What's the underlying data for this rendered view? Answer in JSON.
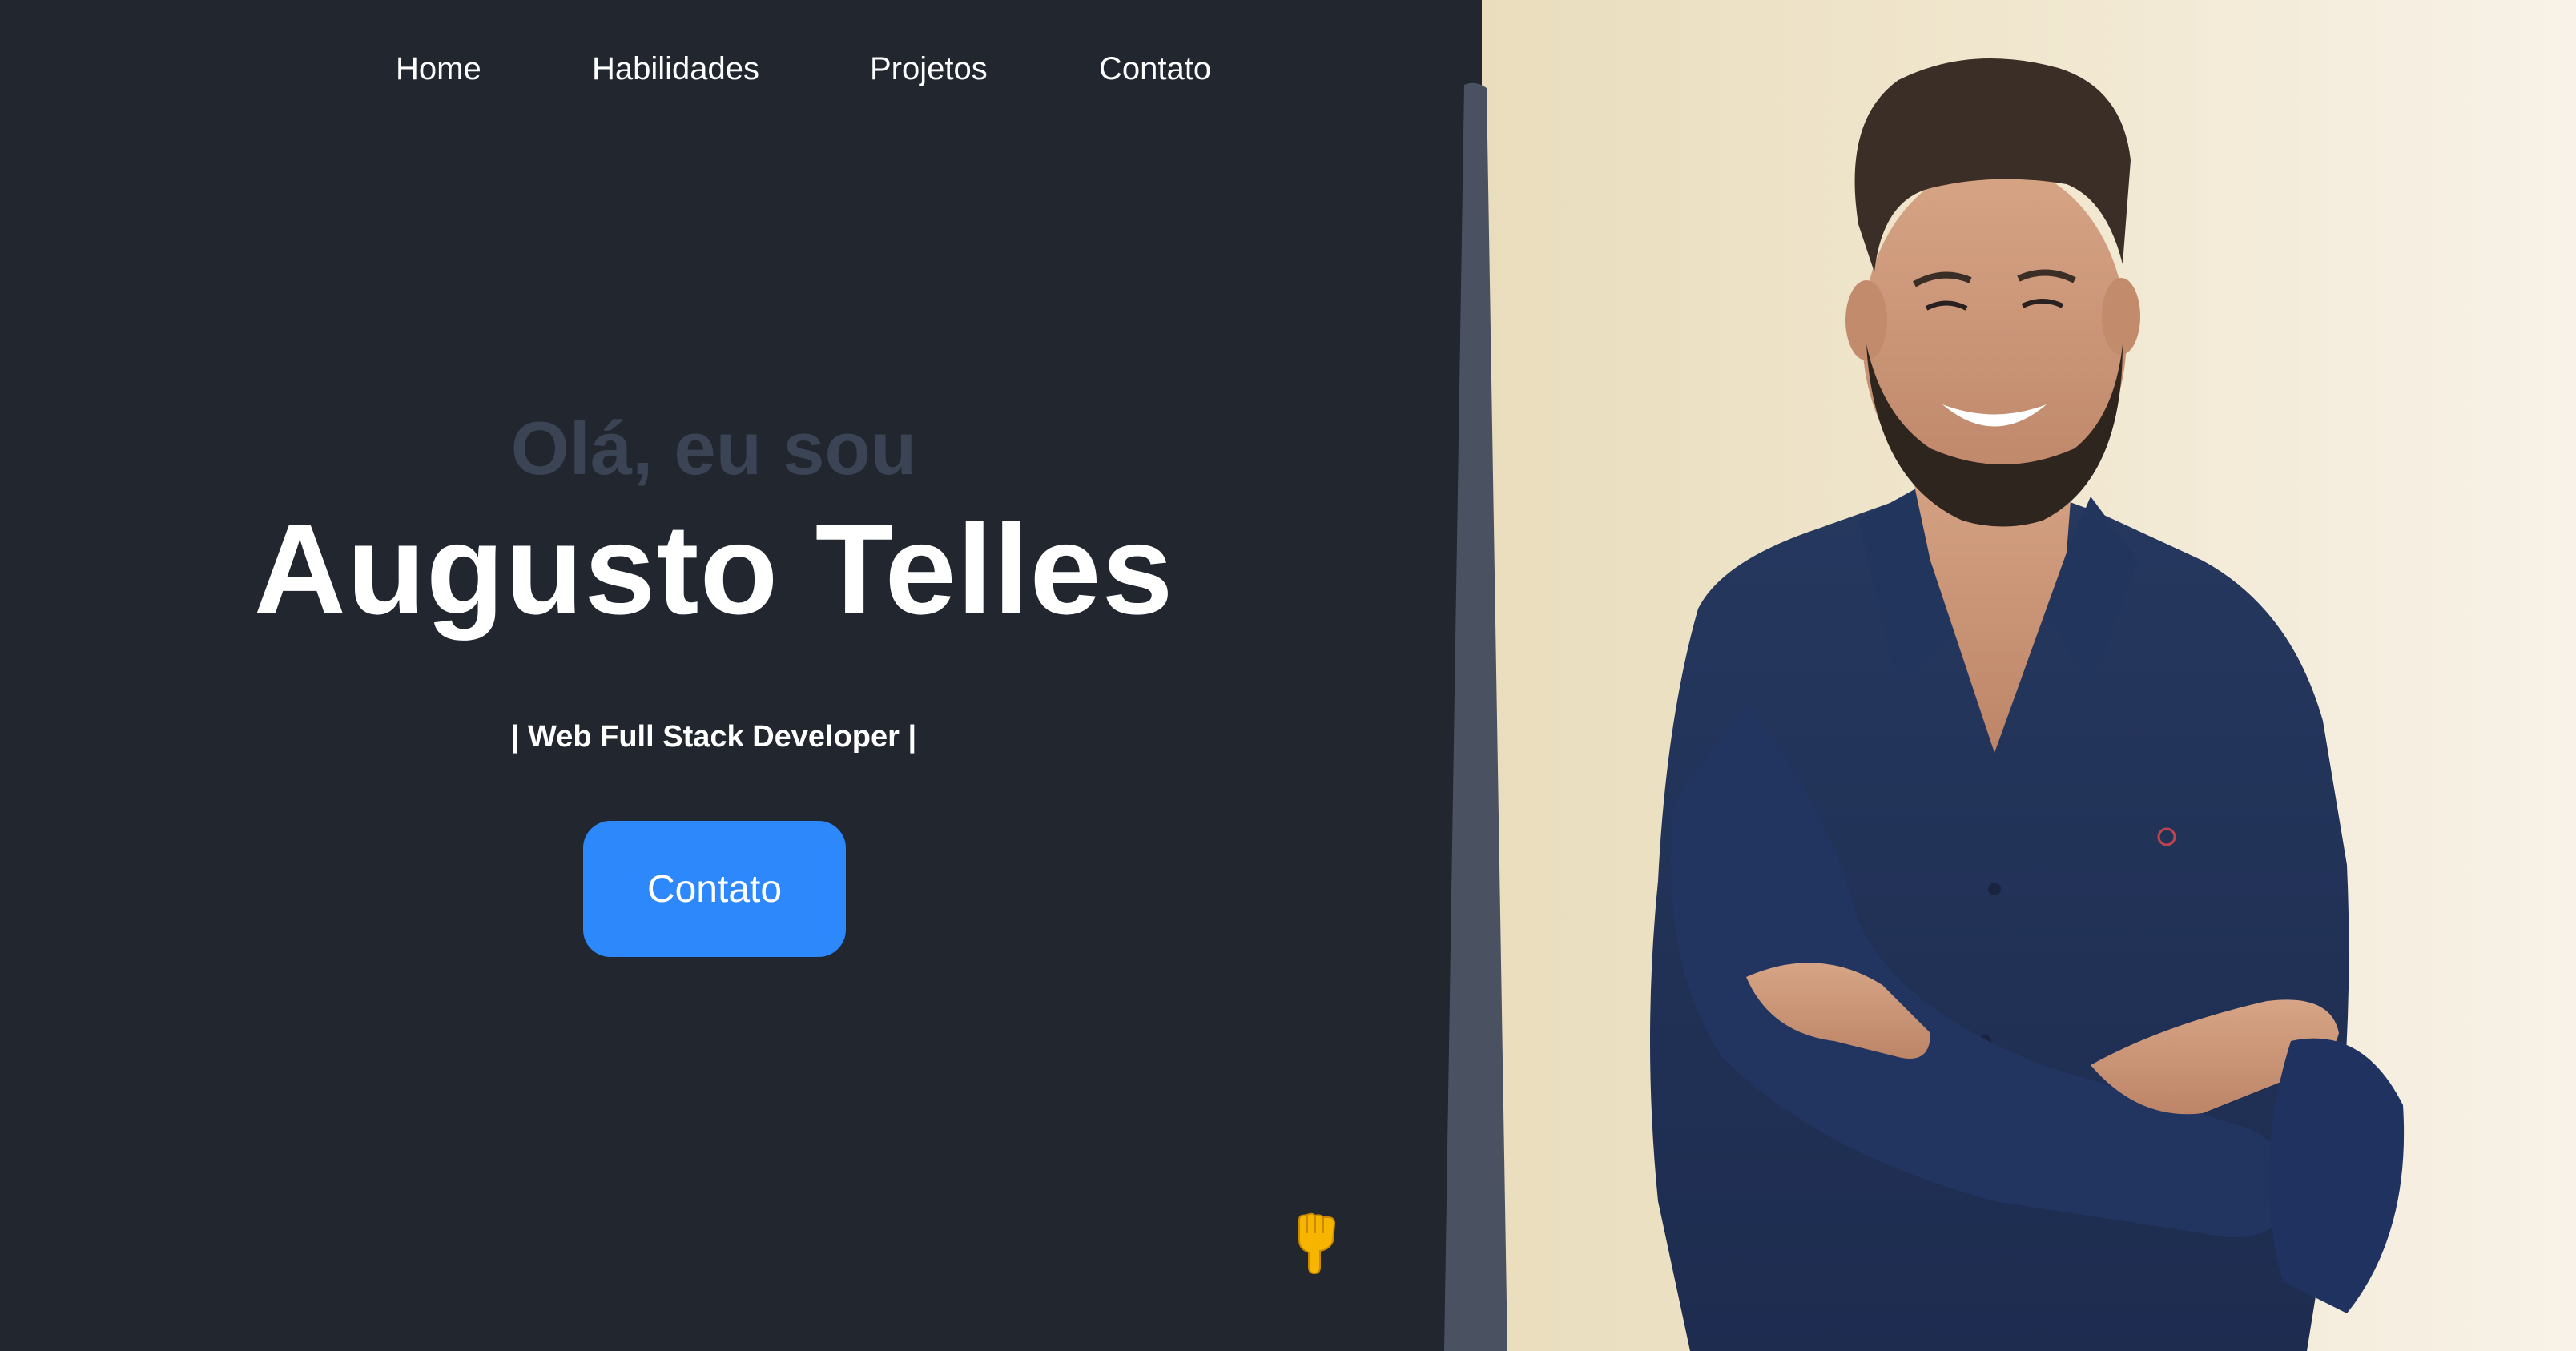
{
  "nav": {
    "items": [
      {
        "label": "Home"
      },
      {
        "label": "Habilidades"
      },
      {
        "label": "Projetos"
      },
      {
        "label": "Contato"
      }
    ]
  },
  "hero": {
    "greeting": "Olá, eu sou",
    "name": "Augusto Telles",
    "role": "| Web Full Stack Developer |",
    "cta_label": "Contato"
  },
  "icons": {
    "scroll_hint": "pointing-down-hand-icon"
  },
  "colors": {
    "background": "#21262f",
    "greeting": "#3b4455",
    "accent": "#2d88fb",
    "divider": "#4a5262",
    "pointer": "#f7b500"
  }
}
